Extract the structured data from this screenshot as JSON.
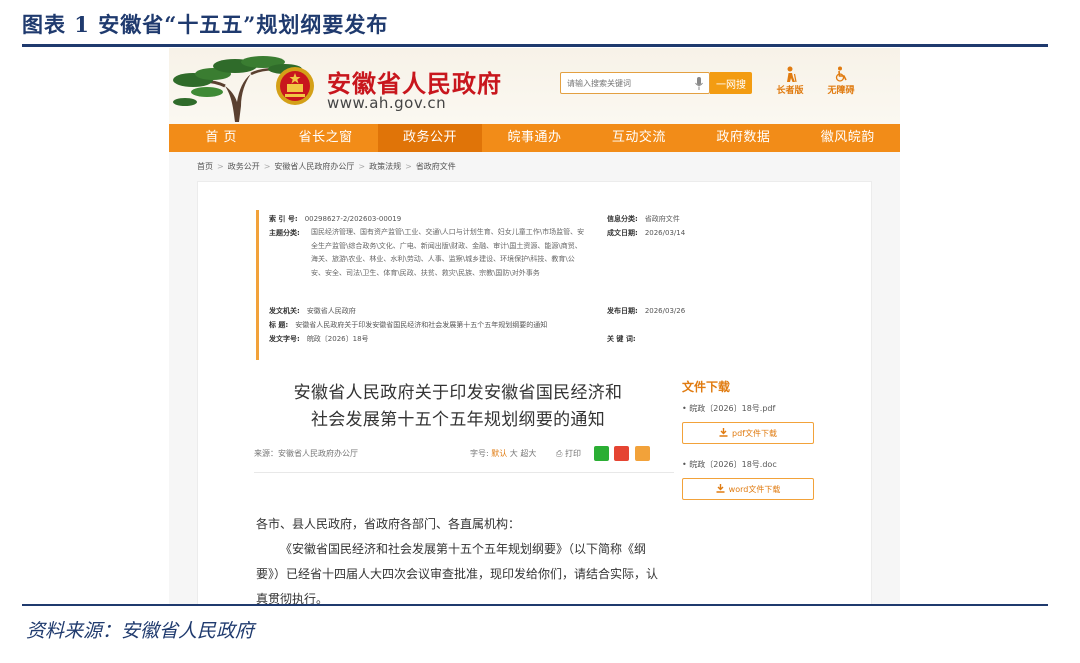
{
  "figure": {
    "title": "图表 1   安徽省“十五五”规划纲要发布",
    "source": "资料来源：安徽省人民政府"
  },
  "site": {
    "name": "安徽省人民政府",
    "url": "www.ah.gov.cn",
    "search_placeholder": "请输入搜索关键词",
    "search_button": "一网搜",
    "elder_mode": "长者版",
    "accessibility": "无障碍"
  },
  "nav": [
    "首 页",
    "省长之窗",
    "政务公开",
    "皖事通办",
    "互动交流",
    "政府数据",
    "徽风皖韵"
  ],
  "nav_active_index": 2,
  "breadcrumb": [
    "首页",
    "政务公开",
    "安徽省人民政府办公厅",
    "政策法规",
    "省政府文件"
  ],
  "meta": {
    "index_label": "索 引 号:",
    "index_value": "00298627-2/202603-00019",
    "theme_label": "主题分类:",
    "theme_value": "国民经济管理、国有资产监管\\工业、交通\\人口与计划生育、妇女儿童工作\\市场监管、安全生产监管\\综合政务\\文化、广电、新闻出版\\财政、金融、审计\\国土资源、能源\\商贸、海关、旅游\\农业、林业、水利\\劳动、人事、监察\\城乡建设、环境保护\\科技、教育\\公安、安全、司法\\卫生、体育\\民政、扶贫、救灾\\民族、宗教\\国防\\对外事务",
    "category_label": "信息分类:",
    "category_value": "省政府文件",
    "created_label": "成文日期:",
    "created_value": "2026/03/14",
    "issuer_label": "发文机关:",
    "issuer_value": "安徽省人民政府",
    "published_label": "发布日期:",
    "published_value": "2026/03/26",
    "title_label": "标      题:",
    "title_value": "安徽省人民政府关于印发安徽省国民经济和社会发展第十五个五年规划纲要的通知",
    "docno_label": "发文字号:",
    "docno_value": "皖政〔2026〕18号",
    "keywords_label": "关 键 词:",
    "keywords_value": ""
  },
  "doc": {
    "title_line1": "安徽省人民政府关于印发安徽省国民经济和",
    "title_line2": "社会发展第十五个五年规划纲要的通知",
    "from": "来源：安徽省人民政府办公厅",
    "fontsize_label": "字号:",
    "fontsize_default": "默认",
    "fontsize_large": "大",
    "fontsize_xlarge": "超大",
    "print": "打印",
    "salutation": "各市、县人民政府，省政府各部门、各直属机构：",
    "paragraph": "《安徽省国民经济和社会发展第十五个五年规划纲要》（以下简称《纲要》）已经省十四届人大四次会议审查批准，现印发给你们，请结合实际，认真贯彻执行。"
  },
  "downloads": {
    "title": "文件下载",
    "file1_name": "皖政〔2026〕18号.pdf",
    "file1_button": "pdf文件下载",
    "file2_name": "皖政〔2026〕18号.doc",
    "file2_button": "word文件下载"
  },
  "colors": {
    "report_blue": "#1f3a6e",
    "nav_orange": "#f28c18",
    "brand_red": "#c8161d",
    "accent_orange": "#e07b10"
  }
}
